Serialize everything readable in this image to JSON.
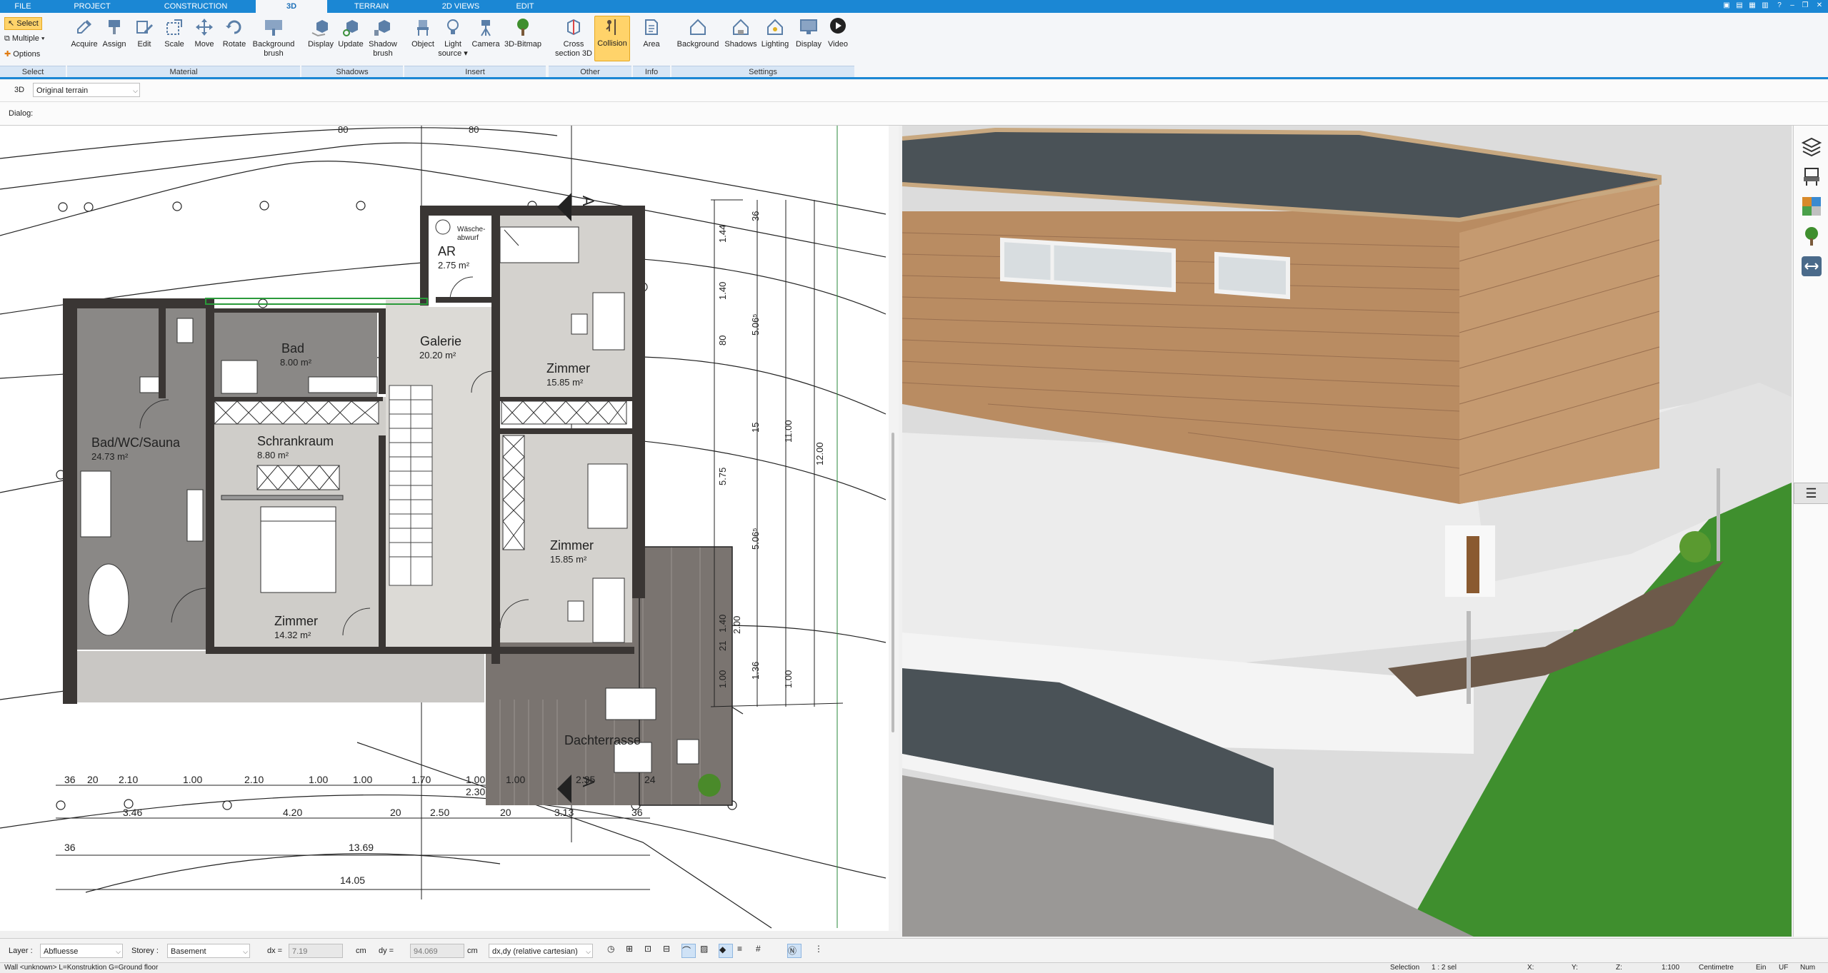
{
  "tabs": [
    {
      "label": "FILE",
      "active": false
    },
    {
      "label": "PROJECT",
      "active": false
    },
    {
      "label": "CONSTRUCTION",
      "active": false
    },
    {
      "label": "3D",
      "active": true
    },
    {
      "label": "TERRAIN",
      "active": false
    },
    {
      "label": "2D VIEWS",
      "active": false
    },
    {
      "label": "EDIT",
      "active": false
    }
  ],
  "ribbon": {
    "select": {
      "select_label": "Select",
      "multiple_label": "Multiple",
      "options_label": "Options",
      "group": "Select"
    },
    "material": {
      "acquire": "Acquire",
      "assign": "Assign",
      "edit": "Edit",
      "scale": "Scale",
      "move": "Move",
      "rotate": "Rotate",
      "background_brush_1": "Background",
      "background_brush_2": "brush",
      "group": "Material"
    },
    "shadows": {
      "display": "Display",
      "update": "Update",
      "shadow_brush_1": "Shadow",
      "shadow_brush_2": "brush",
      "group": "Shadows"
    },
    "insert": {
      "object": "Object",
      "light_source_1": "Light",
      "light_source_2": "source",
      "camera": "Camera",
      "bitmap": "3D-Bitmap",
      "group": "Insert"
    },
    "other": {
      "cross_section_1": "Cross",
      "cross_section_2": "section 3D",
      "collision": "Collision",
      "group": "Other"
    },
    "info": {
      "area": "Area",
      "group": "Info"
    },
    "settings": {
      "background": "Background",
      "shadows": "Shadows",
      "lighting": "Lighting",
      "display": "Display",
      "video": "Video",
      "group": "Settings"
    }
  },
  "toolrow": {
    "mode": "3D",
    "terrain_select": "Original terrain"
  },
  "dialog": {
    "label": "Dialog:"
  },
  "plan": {
    "rooms": [
      {
        "name": "Bad",
        "area": "8.00 m²"
      },
      {
        "name": "Galerie",
        "area": "20.20 m²"
      },
      {
        "name": "AR",
        "area": "2.75 m²"
      },
      {
        "name": "Wäsche-",
        "area": "abwurf"
      },
      {
        "name": "Zimmer",
        "area": "15.85 m²"
      },
      {
        "name": "Bad/WC/Sauna",
        "area": "24.73 m²"
      },
      {
        "name": "Schrankraum",
        "area": "8.80 m²"
      },
      {
        "name": "Zimmer",
        "area": "15.85 m²"
      },
      {
        "name": "Zimmer",
        "area": "14.32 m²"
      },
      {
        "name": "Dachterrasse",
        "area": ""
      }
    ],
    "dims_top": [
      "80",
      "80"
    ],
    "dims_row1": [
      "36",
      "20",
      "2.10",
      "1.00",
      "2.10",
      "1.00",
      "1.00",
      "1.70",
      "1.00",
      "1.00",
      "2.35",
      "24"
    ],
    "dims_row1_extra": "2.30",
    "dims_row2": [
      "3.46",
      "4.20",
      "20",
      "2.50",
      "20",
      "3.13",
      "36"
    ],
    "dims_row3": [
      "36",
      "13.69"
    ],
    "dims_row4": "14.05",
    "dims_right": [
      "36",
      "1.44",
      "1.40",
      "80",
      "5.06⁵",
      "15",
      "5.75",
      "11.00",
      "12.00",
      "5.06⁵",
      "1.40",
      "21",
      "1.36",
      "1.00",
      "2.00",
      "1.00"
    ]
  },
  "bottombar": {
    "layer_label": "Layer :",
    "layer_value": "Abfluesse",
    "storey_label": "Storey :",
    "storey_value": "Basement",
    "dx_label": "dx =",
    "dx_value": "7.19",
    "dx_unit": "cm",
    "dy_label": "dy =",
    "dy_value": "94.069",
    "dy_unit": "cm",
    "coord_mode": "dx,dy (relative cartesian)"
  },
  "statusbar": {
    "left": "Wall <unknown> L=Konstruktion G=Ground floor",
    "selection": "Selection",
    "scale_sel": "1 : 2 sel",
    "x": "X:",
    "y": "Y:",
    "z": "Z:",
    "scale": "1:100",
    "unit": "Centimetre",
    "ein": "Ein",
    "uf": "UF",
    "num": "Num"
  },
  "colors": {
    "accent": "#1b87d4",
    "ribbon_bg": "#f4f6f9",
    "active_button": "#ffd36a",
    "wall": "#3a3634",
    "floor_gray": "#c9c7c4",
    "grass": "#3f8f2e",
    "wood": "#b98c62",
    "roof": "#4a5257"
  }
}
